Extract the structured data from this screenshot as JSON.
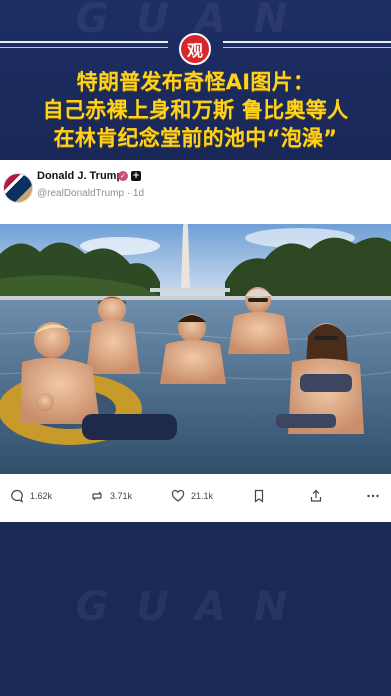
{
  "banner": {
    "logo_char": "观",
    "headline_lines": [
      "特朗普发布奇怪AI图片：",
      "自己赤裸上身和万斯 鲁比奥等人",
      "在林肯纪念堂前的池中“泡澡”"
    ],
    "watermark": "GUAN"
  },
  "post": {
    "author_name": "Donald J. Trump",
    "handle_line": "@realDonaldTrump · 1d",
    "photo": "AI image: five people bathing in the Reflecting Pool with the Washington Monument behind"
  },
  "actions": {
    "replies": "1.62k",
    "reposts": "3.71k",
    "likes": "21.1k"
  },
  "colors": {
    "banner_bg": "#1e2f66",
    "headline": "#ffd21e",
    "badge": "#d9262b",
    "verified": "#d04a7f"
  }
}
